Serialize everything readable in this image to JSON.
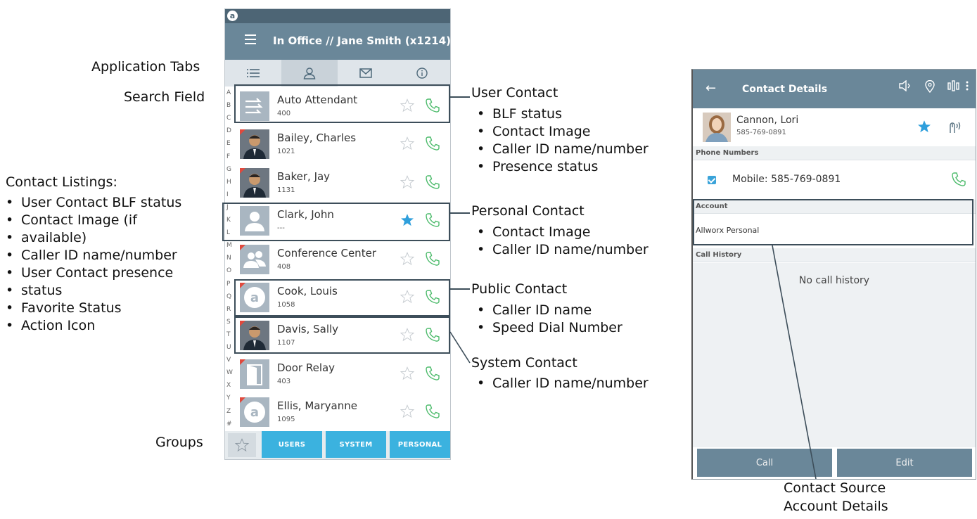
{
  "phone": {
    "status_logo": "a",
    "title": "In Office  //  Jane Smith (x1214)",
    "tabs": [
      {
        "icon": "list-icon"
      },
      {
        "icon": "contacts-icon"
      },
      {
        "icon": "mail-icon"
      },
      {
        "icon": "info-icon"
      }
    ],
    "alphabet": [
      "A",
      "B",
      "C",
      "D",
      "E",
      "F",
      "G",
      "H",
      "I",
      "J",
      "K",
      "L",
      "M",
      "N",
      "O",
      "P",
      "Q",
      "R",
      "S",
      "T",
      "U",
      "V",
      "W",
      "X",
      "Y",
      "Z",
      "#"
    ],
    "contacts": [
      {
        "name": "Auto Attendant",
        "number": "400",
        "favorite": false,
        "avatar": "auto-attendant-icon"
      },
      {
        "name": "Bailey, Charles",
        "number": "1021",
        "favorite": false,
        "avatar": "photo"
      },
      {
        "name": "Baker, Jay",
        "number": "1131",
        "favorite": false,
        "avatar": "photo"
      },
      {
        "name": "Clark, John",
        "number": "---",
        "favorite": true,
        "avatar": "person-icon"
      },
      {
        "name": "Conference Center",
        "number": "408",
        "favorite": false,
        "avatar": "group-icon"
      },
      {
        "name": "Cook, Louis",
        "number": "1058",
        "favorite": false,
        "avatar": "allworx-logo-icon"
      },
      {
        "name": "Davis, Sally",
        "number": "1107",
        "favorite": false,
        "avatar": "photo"
      },
      {
        "name": "Door Relay",
        "number": "403",
        "favorite": false,
        "avatar": "door-icon"
      },
      {
        "name": "Ellis, Maryanne",
        "number": "1095",
        "favorite": false,
        "avatar": "allworx-logo-icon"
      }
    ],
    "groups": [
      "USERS",
      "SYSTEM",
      "PERSONAL"
    ]
  },
  "annotations": {
    "application_tabs": "Application Tabs",
    "search_field": "Search Field",
    "groups": "Groups",
    "contact_listings_title": "Contact Listings:",
    "contact_listings": [
      "User Contact BLF status",
      "Contact Image (if",
      "available)",
      "Caller ID name/number",
      "User Contact presence",
      "status",
      "Favorite Status",
      "Action Icon"
    ],
    "user_contact_title": "User Contact",
    "user_contact": [
      "BLF status",
      "Contact Image",
      "Caller ID name/number",
      "Presence status"
    ],
    "personal_contact_title": "Personal Contact",
    "personal_contact": [
      "Contact Image",
      "Caller ID name/number"
    ],
    "public_contact_title": "Public Contact",
    "public_contact": [
      "Caller ID name",
      "Speed Dial Number"
    ],
    "system_contact_title": "System Contact",
    "system_contact": [
      "Caller ID name/number"
    ],
    "contact_source": [
      "Contact Source",
      "Account Details"
    ]
  },
  "details": {
    "title": "Contact Details",
    "contact_name": "Cannon, Lori",
    "contact_number": "585-769-0891",
    "favorite": true,
    "phone_numbers_header": "Phone Numbers",
    "mobile": "Mobile: 585-769-0891",
    "account_header": "Account",
    "account_value": "Allworx Personal",
    "call_history_header": "Call History",
    "no_history": "No call history",
    "call_button": "Call",
    "edit_button": "Edit"
  },
  "colors": {
    "header": "#6a8799",
    "accent": "#3bb2df",
    "call_green": "#4cbb6b",
    "star_blue": "#2f9fdc"
  }
}
